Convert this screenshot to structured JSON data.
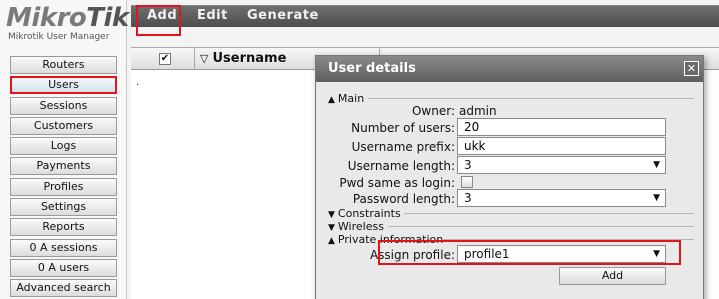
{
  "logo": {
    "brand_main": "Mikro",
    "brand_tik": "Tik",
    "subtitle": "Mikrotik User Manager"
  },
  "sidebar": {
    "items": [
      {
        "label": "Routers"
      },
      {
        "label": "Users"
      },
      {
        "label": "Sessions"
      },
      {
        "label": "Customers"
      },
      {
        "label": "Logs"
      },
      {
        "label": "Payments"
      },
      {
        "label": "Profiles"
      },
      {
        "label": "Settings"
      },
      {
        "label": "Reports"
      },
      {
        "label": "0 A sessions"
      },
      {
        "label": "0 A users"
      },
      {
        "label": "Advanced search"
      }
    ],
    "active_index": 1
  },
  "menubar": {
    "add": "Add",
    "edit": "Edit",
    "generate": "Generate"
  },
  "grid": {
    "check_mark": "✔",
    "username_header": "Username",
    "sort_icon": "▽",
    "row_marker": "."
  },
  "dialog": {
    "title": "User details",
    "close_glyph": "✕",
    "sections": {
      "main": "Main",
      "constraints": "Constraints",
      "wireless": "Wireless",
      "private": "Private information"
    },
    "fields": {
      "owner_label": "Owner:",
      "owner_value": "admin",
      "num_users_label": "Number of users:",
      "num_users_value": "20",
      "prefix_label": "Username prefix:",
      "prefix_value": "ukk",
      "ulen_label": "Username length:",
      "ulen_value": "3",
      "pwd_same_label": "Pwd same as login:",
      "plen_label": "Password length:",
      "plen_value": "3",
      "profile_label": "Assign profile:",
      "profile_value": "profile1"
    },
    "add_button": "Add"
  },
  "colors": {
    "highlight": "#e0141b",
    "menubar": "#5a5a5a",
    "dialog_title": "#6e6e6e"
  }
}
